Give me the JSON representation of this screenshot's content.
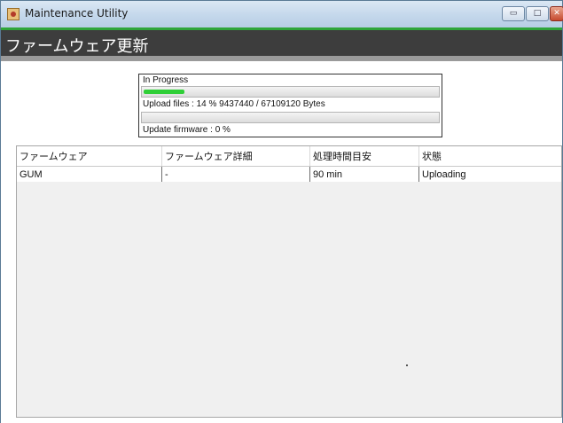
{
  "window": {
    "title": "Maintenance Utility",
    "controls": {
      "minimize": "▭",
      "maximize": "□",
      "close": "✕"
    }
  },
  "header": {
    "title": "ファームウェア更新",
    "accent_color": "#2fa53a"
  },
  "progress": {
    "status_label": "In Progress",
    "upload_label": "Upload files : 14 % 9437440 / 67109120 Bytes",
    "upload_percent": 14,
    "update_label": "Update firmware : 0 %",
    "update_percent": 0,
    "bar_color": "#2fcf37"
  },
  "table": {
    "columns": [
      "ファームウェア",
      "ファームウェア詳細",
      "処理時間目安",
      "状態"
    ],
    "rows": [
      [
        "GUM",
        "-",
        "90 min",
        "Uploading"
      ]
    ]
  },
  "icons": {
    "app": "java-app-icon"
  }
}
